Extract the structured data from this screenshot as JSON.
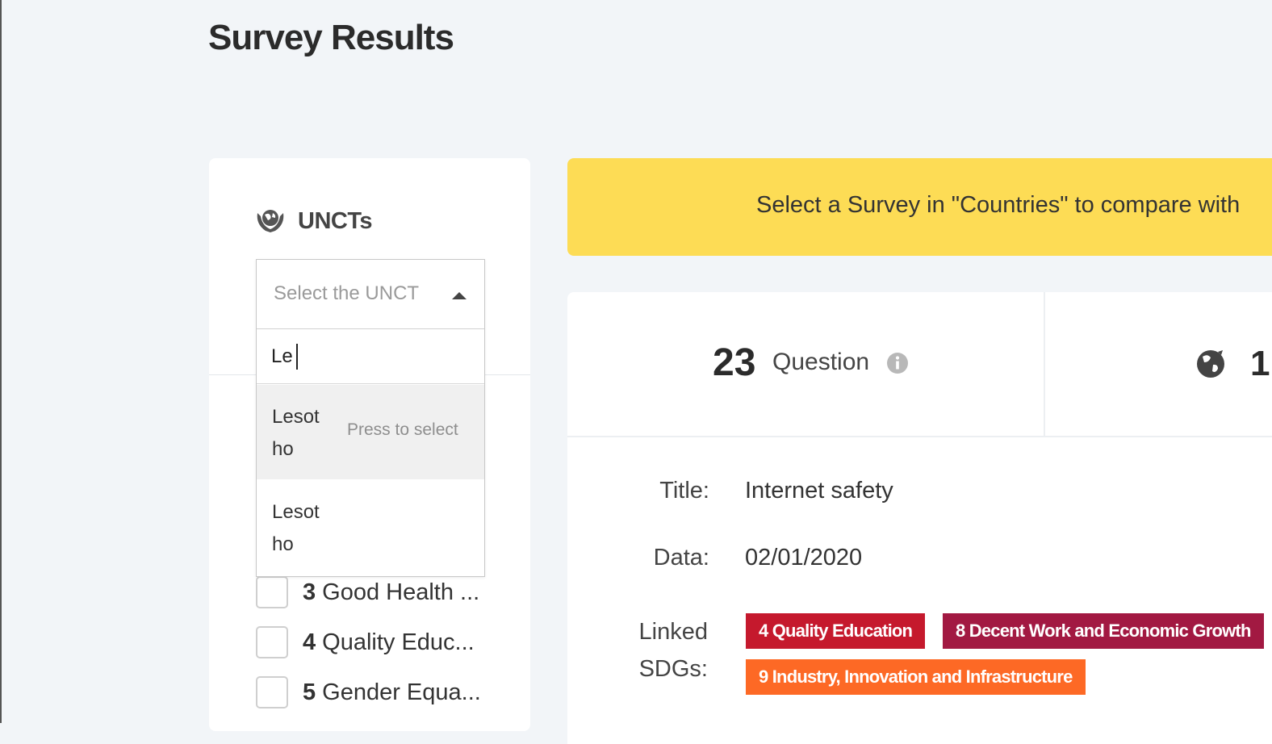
{
  "page": {
    "title": "Survey Results"
  },
  "filters": {
    "unct_label": "UNCTs",
    "select": {
      "placeholder": "Select the UNCT",
      "search_value": "Le",
      "options": [
        {
          "label": "Lesotho",
          "hint": "Press to select"
        },
        {
          "label": "Lesotho"
        }
      ]
    },
    "sdg_filters": [
      {
        "number": "3",
        "name": "Good Health ..."
      },
      {
        "number": "4",
        "name": "Quality Educ..."
      },
      {
        "number": "5",
        "name": "Gender Equa..."
      }
    ]
  },
  "banner": {
    "text": "Select a Survey in \"Countries\" to compare with"
  },
  "survey": {
    "question_count": "23",
    "question_label": "Question",
    "countries_count": "1",
    "title_label": "Title:",
    "title_value": "Internet safety",
    "date_label": "Data:",
    "date_value": "02/01/2020",
    "linked_label": "Linked SDGs:",
    "linked_sdgs": [
      {
        "label": "4 Quality Education",
        "color": "#c5192d"
      },
      {
        "label": "8 Decent Work and Economic Growth",
        "color": "#a21942"
      },
      {
        "label": "9 Industry, Innovation and Infrastructure",
        "color": "#fd6925"
      }
    ]
  },
  "icons": {
    "unct_icon": "un-hands-globe-icon",
    "info_icon": "info-icon",
    "countries_icon": "globe-icon"
  }
}
